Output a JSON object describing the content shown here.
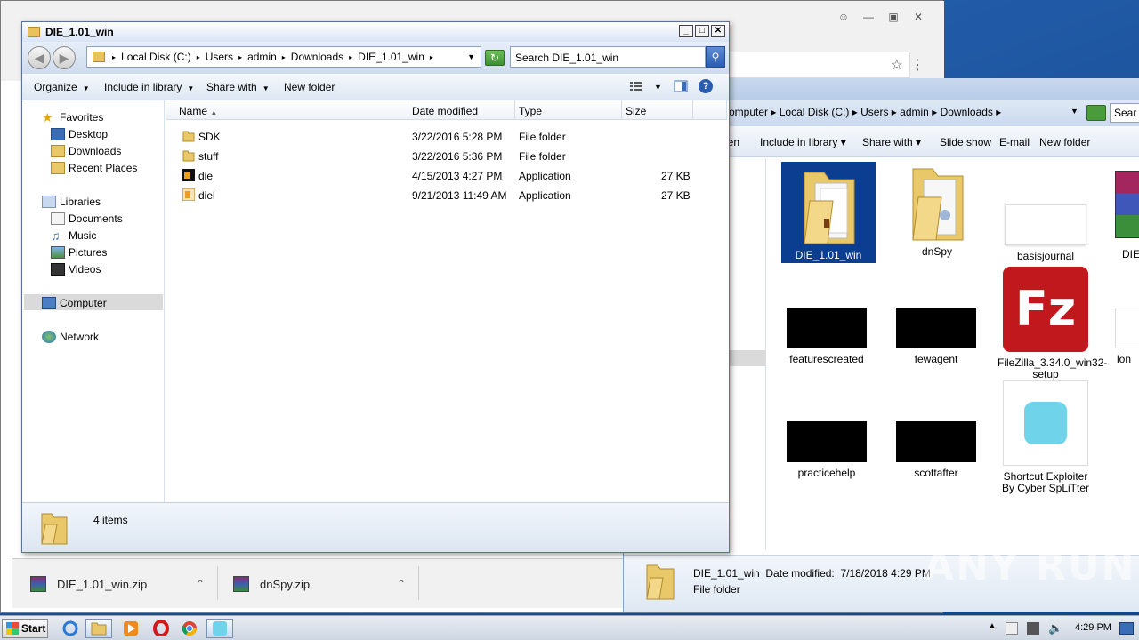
{
  "main_window": {
    "title": "DIE_1.01_win",
    "breadcrumb": [
      "Local Disk (C:)",
      "Users",
      "admin",
      "Downloads",
      "DIE_1.01_win"
    ],
    "search_placeholder": "Search DIE_1.01_win",
    "toolbar": {
      "organize": "Organize",
      "include_in_library": "Include in library",
      "share_with": "Share with",
      "new_folder": "New folder"
    },
    "nav": {
      "favorites": "Favorites",
      "desktop": "Desktop",
      "downloads": "Downloads",
      "recent_places": "Recent Places",
      "libraries": "Libraries",
      "documents": "Documents",
      "music": "Music",
      "pictures": "Pictures",
      "videos": "Videos",
      "computer": "Computer",
      "network": "Network"
    },
    "columns": {
      "name": "Name",
      "date_modified": "Date modified",
      "type": "Type",
      "size": "Size"
    },
    "files": [
      {
        "name": "SDK",
        "date": "3/22/2016 5:28 PM",
        "type": "File folder",
        "size": "",
        "icon": "folder-icon"
      },
      {
        "name": "stuff",
        "date": "3/22/2016 5:36 PM",
        "type": "File folder",
        "size": "",
        "icon": "folder-icon"
      },
      {
        "name": "die",
        "date": "4/15/2013 4:27 PM",
        "type": "Application",
        "size": "27 KB",
        "icon": "die-app-icon"
      },
      {
        "name": "diel",
        "date": "9/21/2013 11:49 AM",
        "type": "Application",
        "size": "27 KB",
        "icon": "diel-app-icon"
      }
    ],
    "status": "4 items"
  },
  "downloads_window": {
    "breadcrumb": [
      "omputer",
      "Local Disk (C:)",
      "Users",
      "admin",
      "Downloads"
    ],
    "search_placeholder": "Sear",
    "toolbar": {
      "open": "pen",
      "include_in_library": "Include in library",
      "share_with": "Share with",
      "slide_show": "Slide show",
      "email": "E-mail",
      "new_folder": "New folder"
    },
    "tiles": [
      {
        "name": "DIE_1.01_win",
        "kind": "folder",
        "selected": true
      },
      {
        "name": "dnSpy",
        "kind": "folder"
      },
      {
        "name": "basisjournal",
        "kind": "white"
      },
      {
        "name": "DIE",
        "kind": "winrar"
      },
      {
        "name": "featurescreated",
        "kind": "black"
      },
      {
        "name": "fewagent",
        "kind": "black"
      },
      {
        "name": "FileZilla_3.34.0_win32-setup",
        "kind": "filezilla"
      },
      {
        "name": "lon",
        "kind": "white"
      },
      {
        "name": "practicehelp",
        "kind": "black"
      },
      {
        "name": "scottafter",
        "kind": "black"
      },
      {
        "name": "Shortcut Exploiter By Cyber SpLiTter",
        "kind": "shortcut"
      }
    ],
    "details": {
      "name": "DIE_1.01_win",
      "date_label": "Date modified:",
      "date_value": "7/18/2018 4:29 PM",
      "type": "File folder"
    }
  },
  "chrome": {
    "downloads": [
      {
        "name": "DIE_1.01_win.zip"
      },
      {
        "name": "dnSpy.zip"
      }
    ]
  },
  "taskbar": {
    "start": "Start",
    "clock": "4:29 PM"
  },
  "watermark": "ANY RUN",
  "colors": {
    "selection": "#0b3d91",
    "desktop": "#1f5fa8",
    "refresh_green": "#3c8f2f"
  }
}
